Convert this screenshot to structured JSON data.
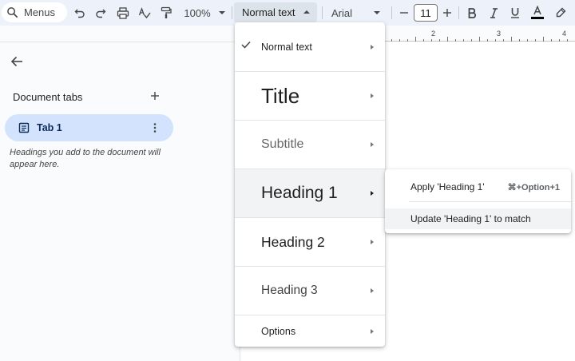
{
  "toolbar": {
    "menus_label": "Menus",
    "zoom": "100%",
    "style_value": "Normal text",
    "font_family": "Arial",
    "font_size": "11",
    "icons": [
      "search-icon",
      "undo-icon",
      "redo-icon",
      "print-icon",
      "spellcheck-icon",
      "paint-format-icon",
      "bold-icon",
      "italic-icon",
      "underline-icon",
      "text-color-icon",
      "highlight-icon"
    ]
  },
  "ruler": {
    "labels": [
      "2",
      "3",
      "4"
    ]
  },
  "sidebar": {
    "title": "Document tabs",
    "tab_label": "Tab 1",
    "hint": "Headings you add to the document will appear here."
  },
  "styles_menu": {
    "items": [
      {
        "label": "Normal text",
        "checked": true
      },
      {
        "label": "Title"
      },
      {
        "label": "Subtitle"
      },
      {
        "label": "Heading 1",
        "hovered": true
      },
      {
        "label": "Heading 2"
      },
      {
        "label": "Heading 3"
      },
      {
        "label": "Options"
      }
    ]
  },
  "submenu": {
    "apply_label": "Apply 'Heading 1'",
    "apply_shortcut": "⌘+Option+1",
    "update_label": "Update 'Heading 1' to match"
  },
  "colors": {
    "accent_pill": "#d3e3fd",
    "toolbar_bg": "#edf2fa",
    "text_color_bar": "#000000"
  }
}
